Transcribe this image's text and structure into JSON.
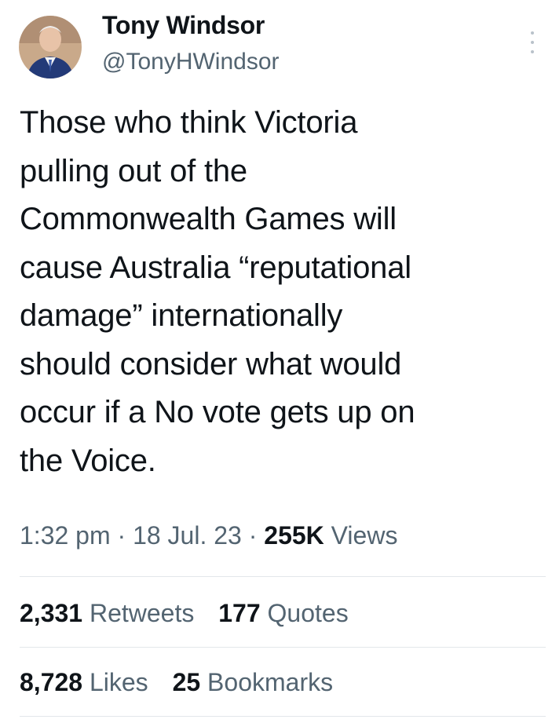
{
  "author": {
    "name": "Tony Windsor",
    "handle": "@TonyHWindsor",
    "avatar_icon": "profile-photo"
  },
  "tweet": {
    "lines": [
      "Those who think Victoria",
      "pulling out of the",
      "Commonwealth Games will",
      "cause Australia “reputational",
      "damage” internationally",
      "should consider what would",
      "occur if a No vote gets up on",
      "the Voice."
    ]
  },
  "meta": {
    "time": "1:32 pm",
    "date": "18 Jul. 23",
    "views_count": "255K",
    "views_label": "Views",
    "separator": "·"
  },
  "stats": {
    "retweets_count": "2,331",
    "retweets_label": "Retweets",
    "quotes_count": "177",
    "quotes_label": "Quotes",
    "likes_count": "8,728",
    "likes_label": "Likes",
    "bookmarks_count": "25",
    "bookmarks_label": "Bookmarks"
  },
  "icons": {
    "more_menu": "more-options-icon"
  },
  "colors": {
    "text": "#0f1419",
    "secondary": "#536471",
    "divider": "#e3e7ea"
  }
}
